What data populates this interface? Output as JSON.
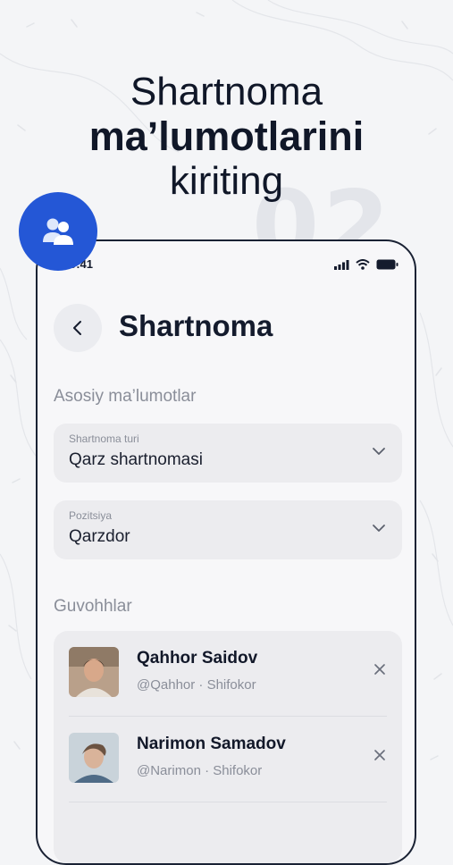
{
  "headline": {
    "line1": "Shartnoma",
    "line2": "ma’lumotlarini",
    "line3": "kiriting"
  },
  "decor": {
    "step_number": "02"
  },
  "badge": {
    "icon": "users-icon",
    "color": "#2457d6"
  },
  "phone": {
    "status_bar": {
      "time": "9:41",
      "icons": [
        "signal-icon",
        "wifi-icon",
        "battery-icon"
      ]
    },
    "title": "Shartnoma",
    "back_icon": "chevron-left-icon",
    "basic_section": {
      "label": "Asosiy ma’lumotlar",
      "fields": [
        {
          "label": "Shartnoma turi",
          "value": "Qarz shartnomasi"
        },
        {
          "label": "Pozitsiya",
          "value": "Qarzdor"
        }
      ]
    },
    "witnesses_section": {
      "label": "Guvohhlar",
      "items": [
        {
          "name": "Qahhor Saidov",
          "handle": "@Qahhor",
          "role": "Shifokor",
          "meta": "@Qahhor · Shifokor"
        },
        {
          "name": "Narimon Samadov",
          "handle": "@Narimon",
          "role": "Shifokor",
          "meta": "@Narimon · Shifokor"
        }
      ]
    }
  },
  "colors": {
    "accent": "#2457d6",
    "text": "#141b2d",
    "muted": "#8a8e99",
    "field_bg": "#ececef"
  }
}
